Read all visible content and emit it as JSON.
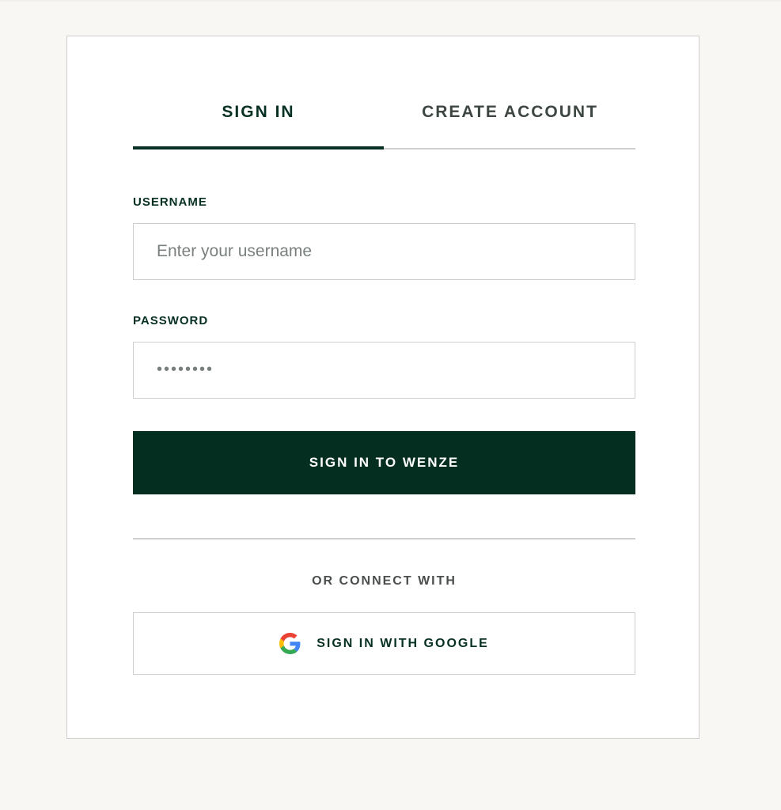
{
  "tabs": {
    "sign_in": "SIGN IN",
    "create_account": "CREATE ACCOUNT"
  },
  "form": {
    "username_label": "USERNAME",
    "username_placeholder": "Enter your username",
    "username_value": "",
    "password_label": "PASSWORD",
    "password_value": "••••••••",
    "submit_label": "SIGN IN TO WENZE"
  },
  "social": {
    "divider_text": "OR CONNECT WITH",
    "google_label": "SIGN IN WITH GOOGLE",
    "google_icon": "google-icon"
  },
  "colors": {
    "brand": "#042e20",
    "page_background": "#f9f7f3",
    "border": "#cfd0ce"
  }
}
